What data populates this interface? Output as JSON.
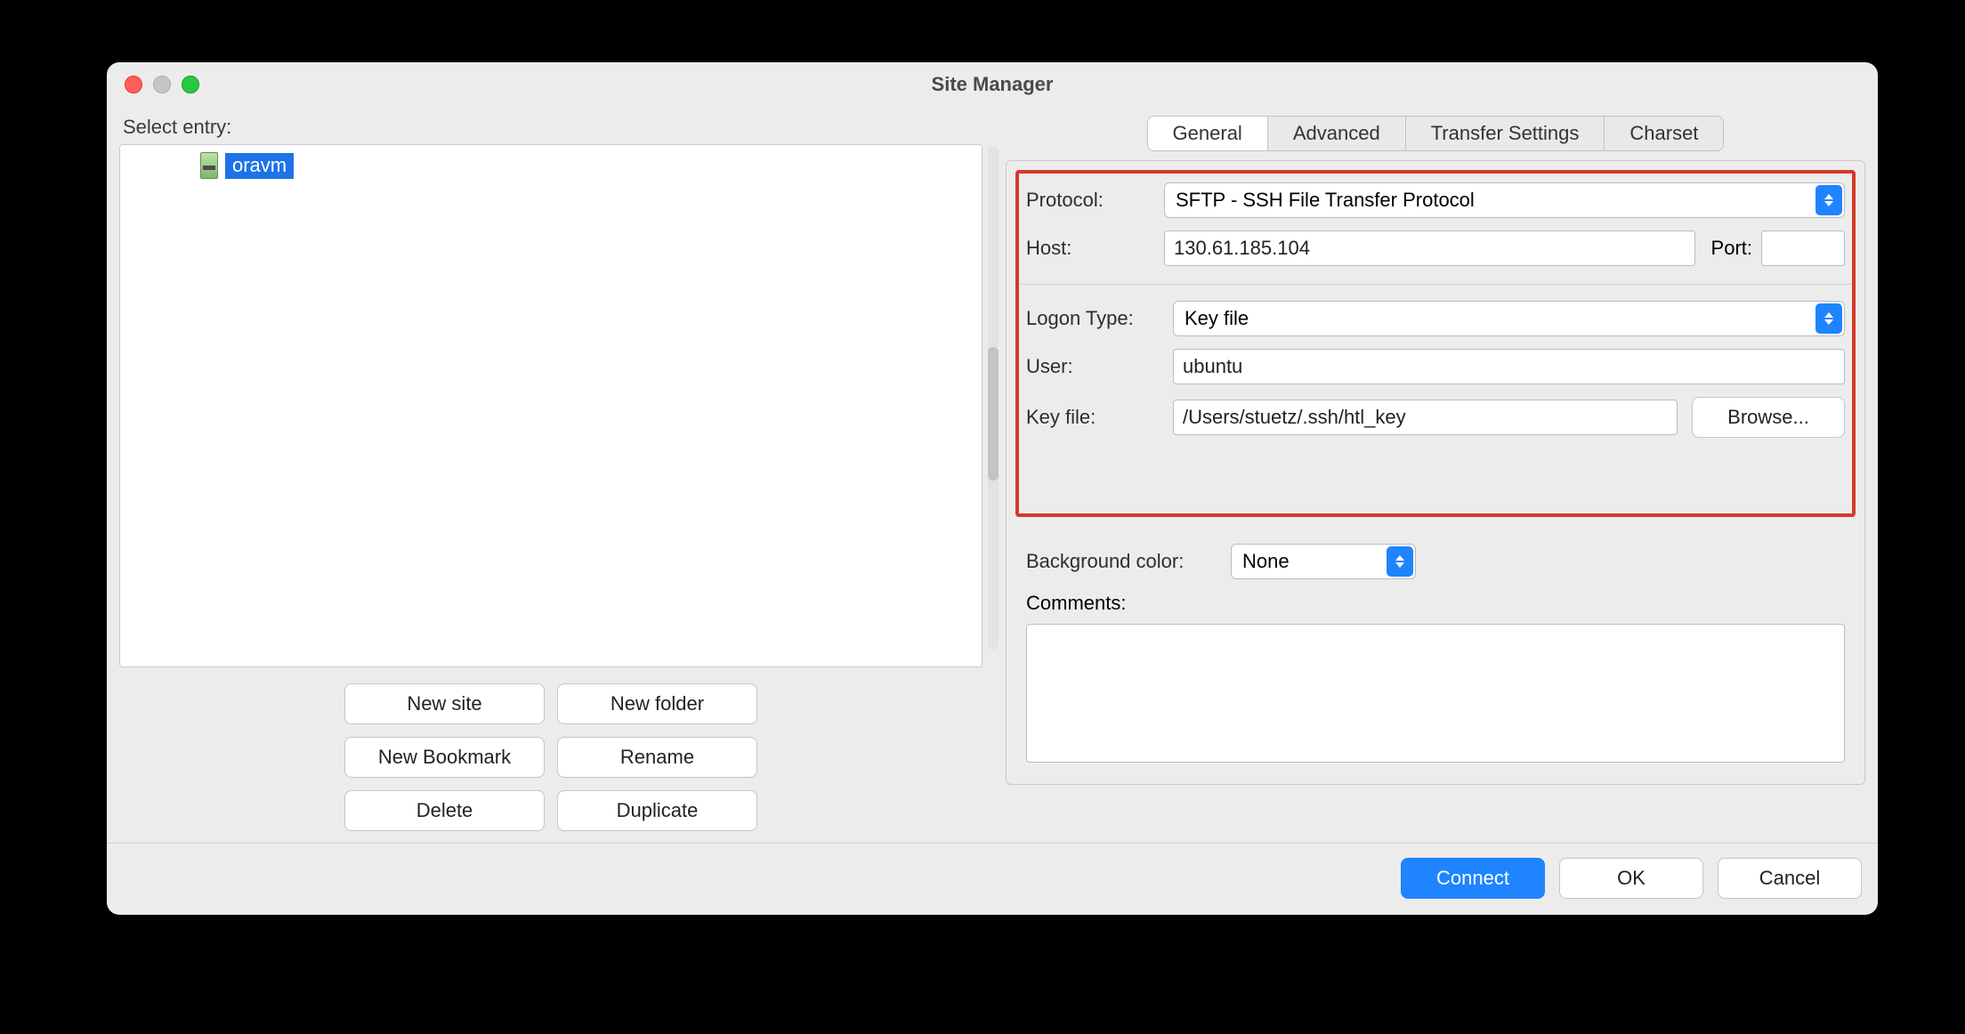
{
  "window": {
    "title": "Site Manager"
  },
  "left": {
    "select_label": "Select entry:",
    "entry": {
      "name": "oravm",
      "selected": true
    },
    "buttons": {
      "new_site": "New site",
      "new_folder": "New folder",
      "new_bookmark": "New Bookmark",
      "rename": "Rename",
      "delete": "Delete",
      "duplicate": "Duplicate"
    }
  },
  "tabs": {
    "general": "General",
    "advanced": "Advanced",
    "transfer": "Transfer Settings",
    "charset": "Charset"
  },
  "general": {
    "protocol_label": "Protocol:",
    "protocol_value": "SFTP - SSH File Transfer Protocol",
    "host_label": "Host:",
    "host_value": "130.61.185.104",
    "port_label": "Port:",
    "port_value": "",
    "logon_type_label": "Logon Type:",
    "logon_type_value": "Key file",
    "user_label": "User:",
    "user_value": "ubuntu",
    "keyfile_label": "Key file:",
    "keyfile_value": "/Users/stuetz/.ssh/htl_key",
    "browse_label": "Browse...",
    "bgcolor_label": "Background color:",
    "bgcolor_value": "None",
    "comments_label": "Comments:",
    "comments_value": ""
  },
  "footer": {
    "connect": "Connect",
    "ok": "OK",
    "cancel": "Cancel"
  }
}
